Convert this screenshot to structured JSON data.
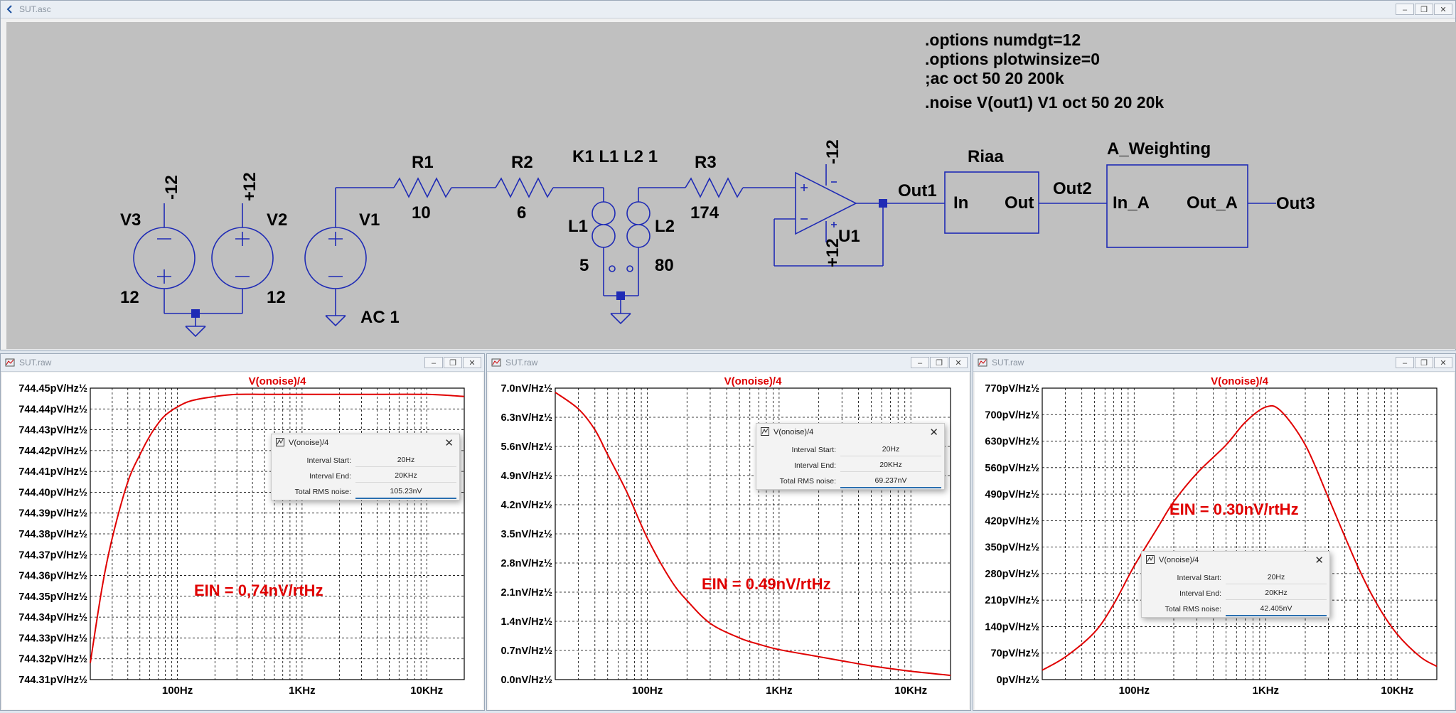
{
  "app": {
    "schematic_title": "SUT.asc",
    "plot_window_title": "SUT.raw"
  },
  "schematic": {
    "directives": [
      ".options numdgt=12",
      ".options plotwinsize=0",
      ";ac oct 50 20 200k",
      ".noise V(out1) V1 oct 50 20 20k"
    ],
    "labels": {
      "v3": "V3",
      "v3_top": "-12",
      "v3_val": "12",
      "v2": "V2",
      "v2_top": "+12",
      "v2_val": "12",
      "v1": "V1",
      "v1_val": "AC 1",
      "r1": "R1",
      "r1_val": "10",
      "r2": "R2",
      "r2_val": "6",
      "k1": "K1 L1 L2 1",
      "l1": "L1",
      "l1_val": "5",
      "l2": "L2",
      "l2_val": "80",
      "r3": "R3",
      "r3_val": "174",
      "u1": "U1",
      "u1_top": "-12",
      "u1_bot": "+12",
      "out1": "Out1",
      "riaa": "Riaa",
      "riaa_in": "In",
      "riaa_out": "Out",
      "out2": "Out2",
      "aw": "A_Weighting",
      "aw_in": "In_A",
      "aw_out": "Out_A",
      "out3": "Out3"
    }
  },
  "plots": [
    {
      "title": "V(onoise)/4",
      "y_ticks": [
        "744.45pV/Hz½",
        "744.44pV/Hz½",
        "744.43pV/Hz½",
        "744.42pV/Hz½",
        "744.41pV/Hz½",
        "744.40pV/Hz½",
        "744.39pV/Hz½",
        "744.38pV/Hz½",
        "744.37pV/Hz½",
        "744.36pV/Hz½",
        "744.35pV/Hz½",
        "744.34pV/Hz½",
        "744.33pV/Hz½",
        "744.32pV/Hz½",
        "744.31pV/Hz½"
      ],
      "x_ticks": [
        "100Hz",
        "1KHz",
        "10KHz"
      ],
      "ein": "EIN = 0,74nV/rtHz",
      "dialog": {
        "title": "V(onoise)/4",
        "interval_start_label": "Interval Start:",
        "interval_start": "20Hz",
        "interval_end_label": "Interval End:",
        "interval_end": "20KHz",
        "total_label": "Total RMS noise:",
        "total": "105.23nV"
      }
    },
    {
      "title": "V(onoise)/4",
      "y_ticks": [
        "7.0nV/Hz½",
        "6.3nV/Hz½",
        "5.6nV/Hz½",
        "4.9nV/Hz½",
        "4.2nV/Hz½",
        "3.5nV/Hz½",
        "2.8nV/Hz½",
        "2.1nV/Hz½",
        "1.4nV/Hz½",
        "0.7nV/Hz½",
        "0.0nV/Hz½"
      ],
      "x_ticks": [
        "100Hz",
        "1KHz",
        "10KHz"
      ],
      "ein": "EIN = 0.49nV/rtHz",
      "dialog": {
        "title": "V(onoise)/4",
        "interval_start_label": "Interval Start:",
        "interval_start": "20Hz",
        "interval_end_label": "Interval End:",
        "interval_end": "20KHz",
        "total_label": "Total RMS noise:",
        "total": "69.237nV"
      }
    },
    {
      "title": "V(onoise)/4",
      "y_ticks": [
        "770pV/Hz½",
        "700pV/Hz½",
        "630pV/Hz½",
        "560pV/Hz½",
        "490pV/Hz½",
        "420pV/Hz½",
        "350pV/Hz½",
        "280pV/Hz½",
        "210pV/Hz½",
        "140pV/Hz½",
        "70pV/Hz½",
        "0pV/Hz½"
      ],
      "x_ticks": [
        "100Hz",
        "1KHz",
        "10KHz"
      ],
      "ein": "EIN = 0.30nV/rtHz",
      "dialog": {
        "title": "V(onoise)/4",
        "interval_start_label": "Interval Start:",
        "interval_start": "20Hz",
        "interval_end_label": "Interval End:",
        "interval_end": "20KHz",
        "total_label": "Total RMS noise:",
        "total": "42.405nV"
      }
    }
  ],
  "chart_data": [
    {
      "type": "line",
      "title": "V(onoise)/4",
      "xscale": "log",
      "xlim": [
        "20Hz",
        "20KHz"
      ],
      "ylim": [
        744.31,
        744.45
      ],
      "yunit": "pV/Hz½",
      "grid": true,
      "series": [
        {
          "name": "V(onoise)/4",
          "x": [
            20,
            25,
            30,
            40,
            50,
            60,
            70,
            80,
            100,
            130,
            200,
            300,
            500,
            1000,
            3000,
            10000,
            20000
          ],
          "values": [
            744.318,
            744.355,
            744.378,
            744.405,
            744.418,
            744.427,
            744.433,
            744.437,
            744.441,
            744.444,
            744.446,
            744.447,
            744.447,
            744.447,
            744.447,
            744.447,
            744.446
          ]
        }
      ]
    },
    {
      "type": "line",
      "title": "V(onoise)/4",
      "xscale": "log",
      "xlim": [
        "20Hz",
        "20KHz"
      ],
      "ylim": [
        0,
        7.0
      ],
      "yunit": "nV/Hz½",
      "grid": true,
      "series": [
        {
          "name": "V(onoise)/4",
          "x": [
            20,
            30,
            40,
            50,
            70,
            100,
            150,
            200,
            300,
            500,
            700,
            1000,
            2000,
            3000,
            5000,
            10000,
            20000
          ],
          "values": [
            6.9,
            6.5,
            6.0,
            5.4,
            4.5,
            3.4,
            2.4,
            1.9,
            1.35,
            1.0,
            0.85,
            0.72,
            0.55,
            0.45,
            0.33,
            0.2,
            0.1
          ]
        }
      ]
    },
    {
      "type": "line",
      "title": "V(onoise)/4",
      "xscale": "log",
      "xlim": [
        "20Hz",
        "20KHz"
      ],
      "ylim": [
        0,
        770
      ],
      "yunit": "pV/Hz½",
      "grid": true,
      "series": [
        {
          "name": "V(onoise)/4",
          "x": [
            20,
            30,
            50,
            70,
            100,
            150,
            200,
            300,
            500,
            700,
            1000,
            1300,
            2000,
            3000,
            5000,
            7000,
            10000,
            15000,
            20000
          ],
          "values": [
            25,
            60,
            125,
            200,
            300,
            400,
            470,
            545,
            620,
            680,
            720,
            710,
            620,
            480,
            300,
            200,
            120,
            60,
            35
          ]
        }
      ]
    }
  ]
}
